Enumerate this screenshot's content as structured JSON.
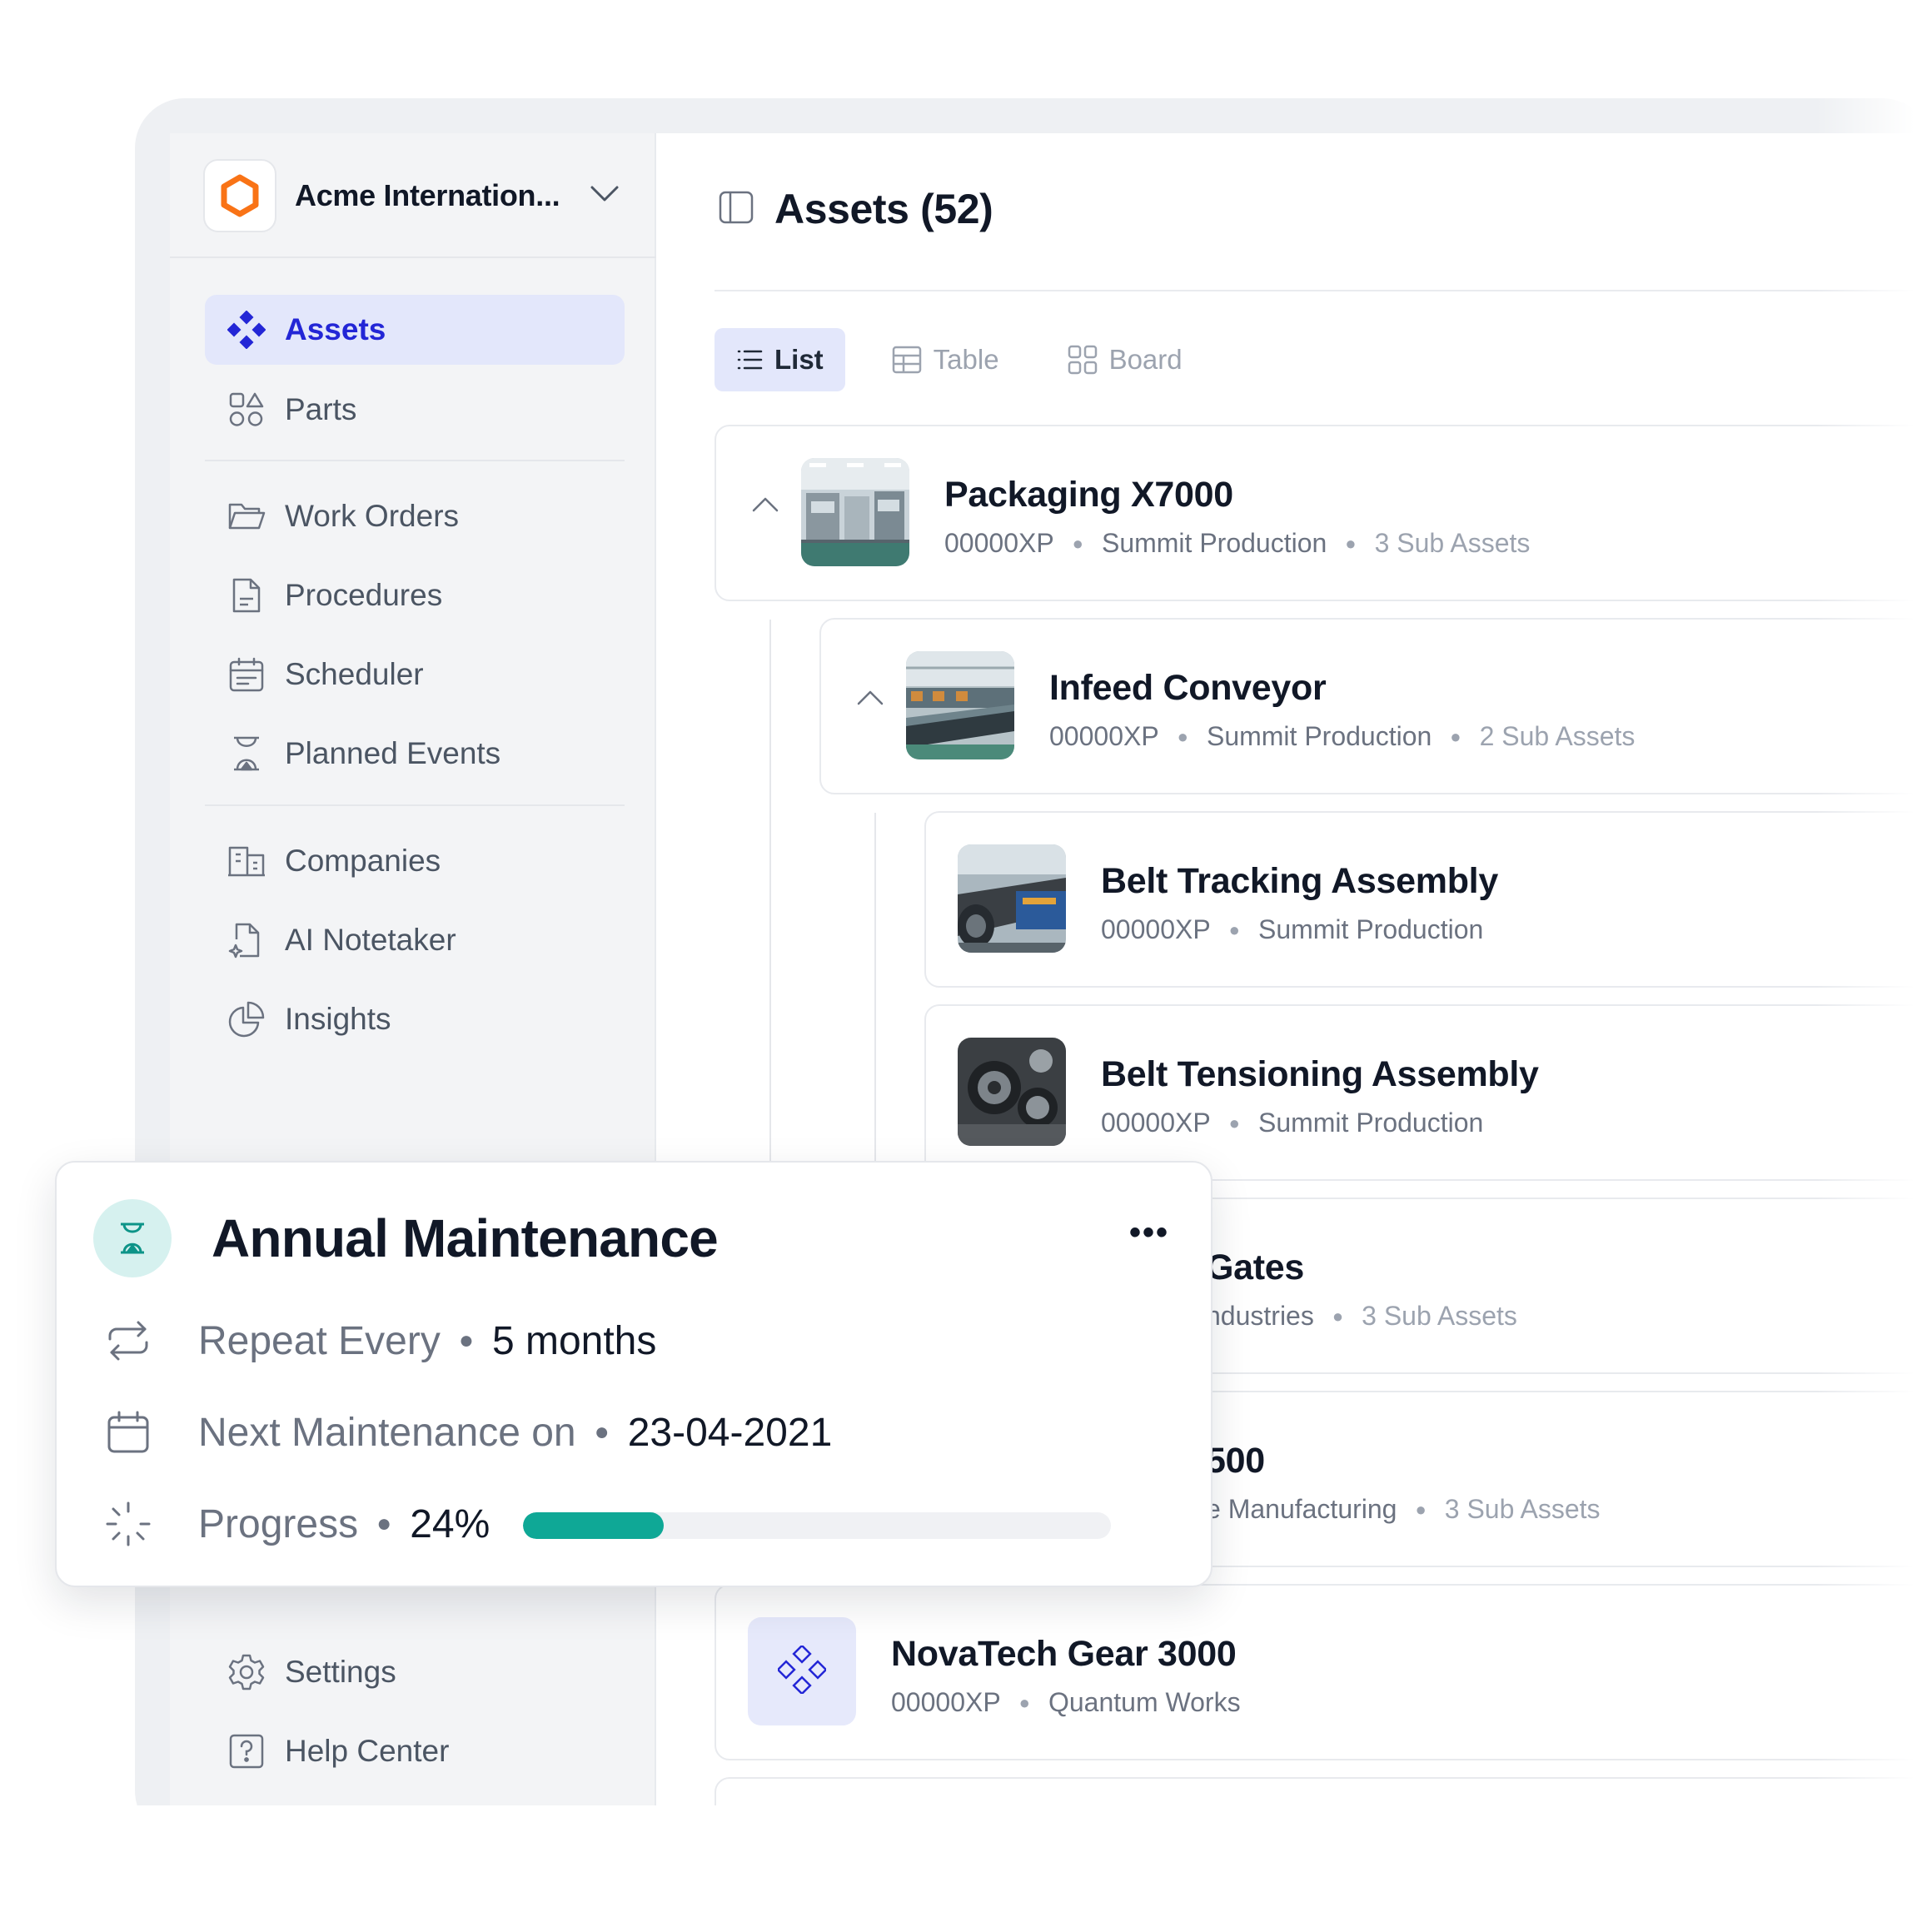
{
  "workspace": {
    "name": "Acme Internation...",
    "logo_icon": "hexagon-logo-icon",
    "brand_color": "#f97316"
  },
  "sidebar": {
    "items": [
      {
        "label": "Assets",
        "icon": "assets-icon",
        "active": true
      },
      {
        "label": "Parts",
        "icon": "parts-icon"
      },
      {
        "label": "Work Orders",
        "icon": "folder-icon"
      },
      {
        "label": "Procedures",
        "icon": "document-icon"
      },
      {
        "label": "Scheduler",
        "icon": "calendar-icon"
      },
      {
        "label": "Planned Events",
        "icon": "hourglass-icon"
      },
      {
        "label": "Companies",
        "icon": "building-icon"
      },
      {
        "label": "AI Notetaker",
        "icon": "ai-note-icon"
      },
      {
        "label": "Insights",
        "icon": "pie-chart-icon"
      }
    ],
    "footer": [
      {
        "label": "Settings",
        "icon": "gear-icon"
      },
      {
        "label": "Help Center",
        "icon": "help-icon"
      }
    ]
  },
  "main": {
    "title": "Assets (52)",
    "tabs": [
      {
        "label": "List",
        "icon": "list-icon",
        "active": true
      },
      {
        "label": "Table",
        "icon": "table-icon"
      },
      {
        "label": "Board",
        "icon": "board-icon"
      }
    ],
    "assets": [
      {
        "name": "Packaging X7000",
        "code": "00000XP",
        "company": "Summit Production",
        "sub": "3 Sub Assets"
      },
      {
        "name": "Infeed Conveyor",
        "code": "00000XP",
        "company": "Summit Production",
        "sub": "2 Sub Assets"
      },
      {
        "name": "Belt Tracking Assembly",
        "code": "00000XP",
        "company": "Summit Production"
      },
      {
        "name": "Belt Tensioning Assembly",
        "code": "00000XP",
        "company": "Summit Production"
      },
      {
        "name": "Gates",
        "company": "ndustries",
        "sub": "3 Sub Assets"
      },
      {
        "name": "500",
        "company": "e Manufacturing",
        "sub": "3 Sub Assets"
      },
      {
        "name": "NovaTech Gear 3000",
        "code": "00000XP",
        "company": "Quantum Works"
      }
    ]
  },
  "popup": {
    "title": "Annual Maintenance",
    "icon": "hourglass-icon",
    "more_label": "•••",
    "repeat_label": "Repeat Every",
    "repeat_value": "5 months",
    "next_label": "Next Maintenance on",
    "next_value": "23-04-2021",
    "progress_label": "Progress",
    "progress_value": "24%",
    "progress_fraction": 0.24,
    "accent": "#0fa896"
  }
}
